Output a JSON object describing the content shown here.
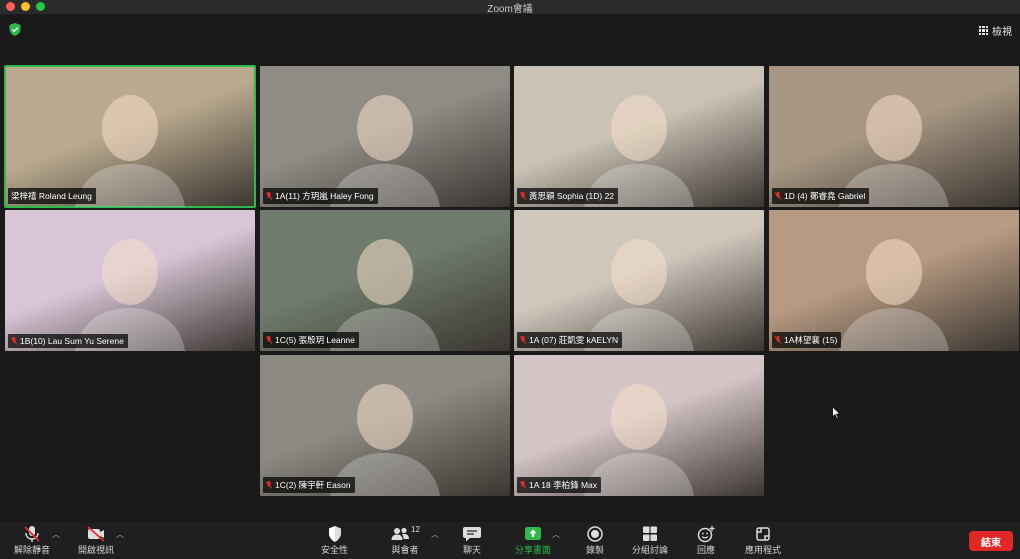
{
  "window": {
    "title": "Zoom會議"
  },
  "header": {
    "view_label": "檢視"
  },
  "participants": [
    {
      "name": "梁梓禧 Roland Leung",
      "muted": false,
      "active": true,
      "bg": "#b9a98e"
    },
    {
      "name": "1A(11) 方玥嵐 Haley Fong",
      "muted": true,
      "active": false,
      "bg": "#8f8c86"
    },
    {
      "name": "黃思穎 Sophia (1D) 22",
      "muted": true,
      "active": false,
      "bg": "#c9c2b5"
    },
    {
      "name": "1D (4) 鄭睿堯 Gabriel",
      "muted": true,
      "active": false,
      "bg": "#a79683"
    },
    {
      "name": "1B(10) Lau Sum Yu Serene",
      "muted": true,
      "active": false,
      "bg": "#d8c6d6"
    },
    {
      "name": "1C(5) 張殷玥 Leanne",
      "muted": true,
      "active": false,
      "bg": "#6f7b6c"
    },
    {
      "name": "1A (07) 莊凱雯 kAELYN",
      "muted": true,
      "active": false,
      "bg": "#cfc7bc"
    },
    {
      "name": "1A林望襄 (15)",
      "muted": true,
      "active": false,
      "bg": "#b79a82"
    },
    {
      "name": "1C(2) 陳宇軒 Eason",
      "muted": true,
      "active": false,
      "bg": "#8c8a82"
    },
    {
      "name": "1A 18 李柏鋒 Max",
      "muted": true,
      "active": false,
      "bg": "#d3c4c6"
    }
  ],
  "toolbar": {
    "unmute_label": "解除靜音",
    "start_video_label": "開啟視訊",
    "security_label": "安全性",
    "participants_label": "與會者",
    "participants_count": "12",
    "chat_label": "聊天",
    "share_label": "分享畫面",
    "record_label": "錄製",
    "breakout_label": "分組討論",
    "reactions_label": "回應",
    "apps_label": "應用程式",
    "end_label": "結束"
  },
  "colors": {
    "active_speaker": "#2fb84b",
    "share_green": "#2fb84b",
    "end_red": "#e02828",
    "muted_red": "#e0302e"
  }
}
